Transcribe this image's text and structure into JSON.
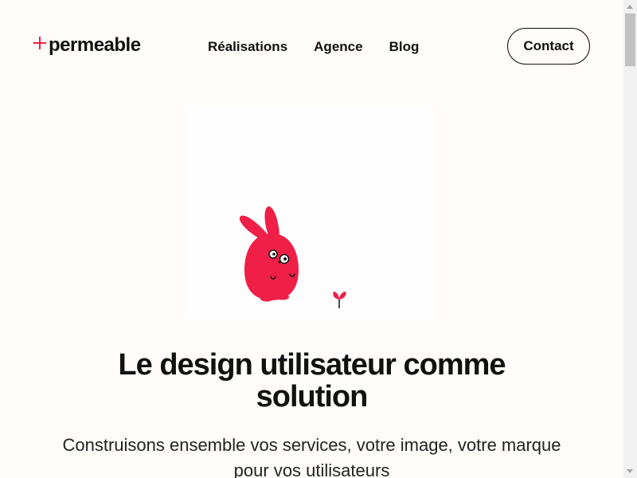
{
  "header": {
    "logo_text": "permeable",
    "logo_mark": "plus-icon",
    "nav": [
      {
        "label": "Réalisations"
      },
      {
        "label": "Agence"
      },
      {
        "label": "Blog"
      }
    ],
    "contact_label": "Contact"
  },
  "hero": {
    "illustration": "red-rabbit-with-sprout",
    "title_line1": "Le design utilisateur comme",
    "title_line2": "solution",
    "subtitle_line1": "Construisons ensemble vos services, votre image, votre marque",
    "subtitle_line2": "pour vos utilisateurs"
  },
  "colors": {
    "background": "#fffcf9",
    "accent": "#ef1f47",
    "text": "#111111"
  }
}
